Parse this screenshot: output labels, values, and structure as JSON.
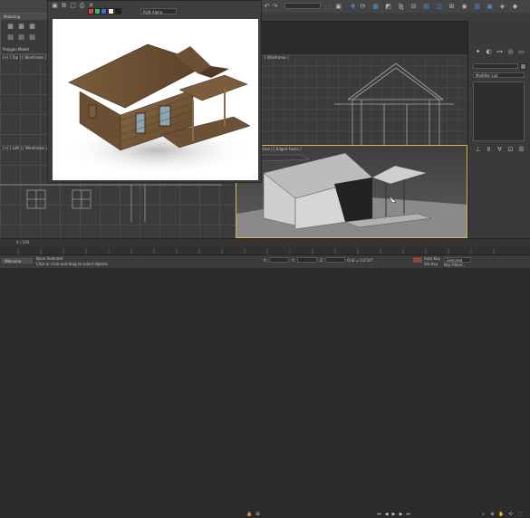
{
  "toolbar": {
    "workspace_dropdown": "",
    "selection_filter": "",
    "tools": [
      "undo-icon",
      "redo-icon",
      "link-icon",
      "unlink-icon",
      "bind-icon",
      "select-icon",
      "region-select-icon",
      "move-icon",
      "rotate-icon",
      "scale-icon",
      "snap-icon",
      "mirror-icon",
      "align-icon",
      "layer-icon",
      "curve-editor-icon",
      "schematic-icon",
      "material-editor-icon",
      "render-setup-icon",
      "render-frame-icon",
      "render-icon"
    ]
  },
  "ribbon": {
    "title": "Modeling",
    "subtitle": "Polygon Model"
  },
  "render_frame": {
    "channel_dropdown": "RGB Alpha"
  },
  "viewports": {
    "top_label": "[+] [ Top ] [ Wireframe ]",
    "left_label": "[+] [ Left ] [ Wireframe ]",
    "front_label": "[ Wireframe ]",
    "persp_label": "[+] [ Perspective ] [ Edged Faces ]"
  },
  "command_panel": {
    "modifier_list": "Modifier List"
  },
  "timeline": {
    "frame_counter": "0 / 100"
  },
  "status": {
    "welcome": "Welcome",
    "selection": "None Selected",
    "prompt": "Click or click-and-drag to select objects",
    "x_label": "X:",
    "y_label": "Y:",
    "z_label": "Z:",
    "grid": "Grid = 0.0'10\"",
    "auto_key": "Auto Key",
    "set_key": "Set Key",
    "selected": "Selected",
    "key_filters": "Key Filters..."
  },
  "colors": {
    "accent_blue": "#4f8ed9",
    "active_viewport": "#d9b84a",
    "auto_key_red": "#b03a2e"
  }
}
